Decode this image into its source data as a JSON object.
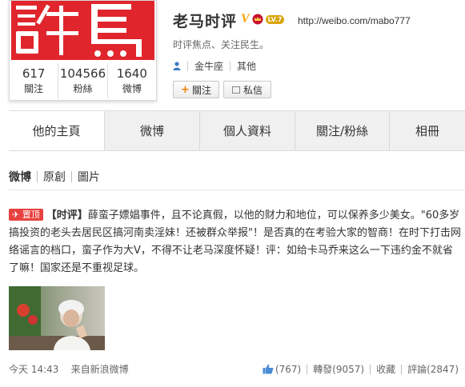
{
  "profile": {
    "name": "老马时评",
    "verified_mark": "V",
    "level_label": "LV.7",
    "url": "http://weibo.com/mabo777",
    "bio": "时评焦点、关注民生。",
    "zodiac": "金牛座",
    "other": "其他",
    "avatar_text": "評馬",
    "follow_label": "關注",
    "message_label": "私信",
    "icons": [
      "person-icon",
      "crown-icon",
      "envelope-icon"
    ]
  },
  "stats": [
    {
      "value": "617",
      "label": "關注"
    },
    {
      "value": "104566",
      "label": "粉絲"
    },
    {
      "value": "1640",
      "label": "微博"
    }
  ],
  "tabs": [
    {
      "label": "他的主頁",
      "active": true
    },
    {
      "label": "微博",
      "active": false
    },
    {
      "label": "個人資料",
      "active": false
    },
    {
      "label": "關注/粉絲",
      "active": false
    },
    {
      "label": "相冊",
      "active": false
    }
  ],
  "subnav": [
    "微博",
    "原創",
    "圖片"
  ],
  "post": {
    "pin_label": "置顶",
    "topic": "【时评】",
    "text": "薛蛮子嫖娼事件，且不论真假，以他的财力和地位，可以保养多少美女。\"60多岁搞投资的老头去居民区搞河南卖淫妹！还被群众举报\"！是否真的在考验大家的智商！在时下打击网络谣言的档口，蛮子作为大V，不得不让老马深度怀疑！评：如给卡马乔来这么一下违约金不就省了嘛！国家还是不重视足球。",
    "time": "今天 14:43",
    "source": "来自新浪微博",
    "like_count": "(767)",
    "repost": "轉發(9057)",
    "favorite": "收藏",
    "comment": "評論(2847)"
  },
  "colors": {
    "brand_red": "#e0262c",
    "accent_orange": "#f37e00",
    "badge_gold": "#d9a400"
  }
}
